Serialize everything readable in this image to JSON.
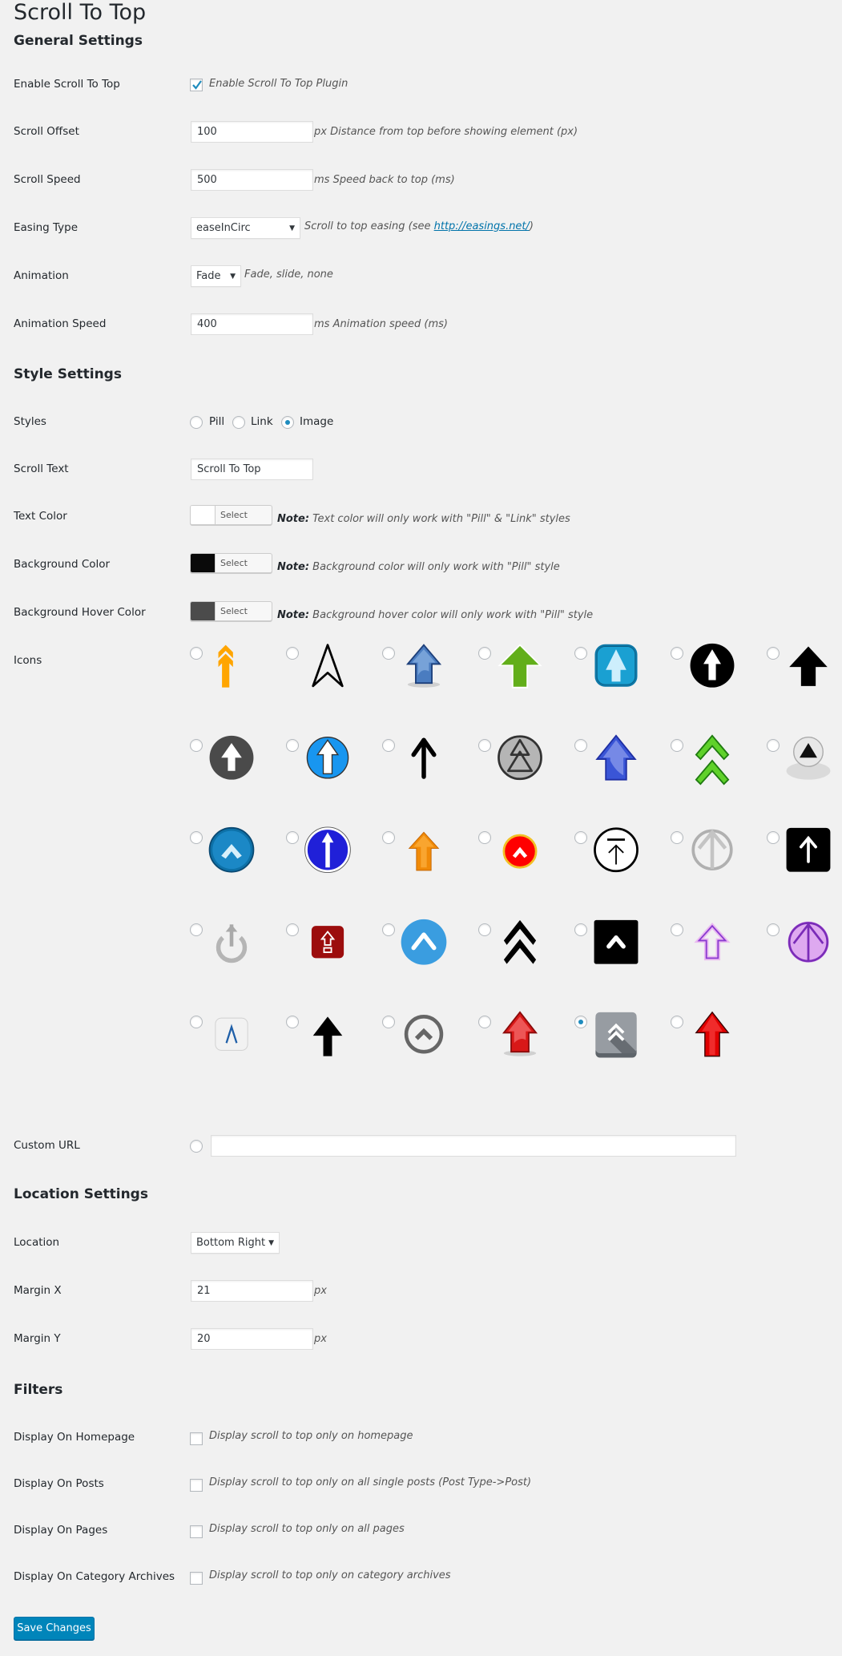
{
  "page": {
    "title": "Scroll To Top"
  },
  "general": {
    "heading": "General Settings",
    "enable": {
      "label": "Enable Scroll To Top",
      "checked": true,
      "desc": "Enable Scroll To Top Plugin"
    },
    "offset": {
      "label": "Scroll Offset",
      "value": "100",
      "desc": "px Distance from top before showing element (px)"
    },
    "speed": {
      "label": "Scroll Speed",
      "value": "500",
      "desc": "ms Speed back to top (ms)"
    },
    "easing": {
      "label": "Easing Type",
      "value": "easeInCirc",
      "desc_prefix": "Scroll to top easing (see ",
      "link": "http://easings.net/",
      "desc_suffix": ")"
    },
    "animation": {
      "label": "Animation",
      "value": "Fade",
      "desc": "Fade, slide, none"
    },
    "anim_speed": {
      "label": "Animation Speed",
      "value": "400",
      "desc": "ms Animation speed (ms)"
    }
  },
  "style": {
    "heading": "Style Settings",
    "styles": {
      "label": "Styles",
      "options": [
        "Pill",
        "Link",
        "Image"
      ],
      "selected": "Image"
    },
    "scroll_text": {
      "label": "Scroll Text",
      "value": "Scroll To Top"
    },
    "text_color": {
      "label": "Text Color",
      "swatch": "#ffffff",
      "button": "Select Color",
      "note_bold": "Note:",
      "note": " Text color will only work with \"Pill\" & \"Link\" styles"
    },
    "bg_color": {
      "label": "Background Color",
      "swatch": "#0a0a0a",
      "button": "Select Color",
      "note_bold": "Note:",
      "note": " Background color will only work with \"Pill\" style"
    },
    "bg_hover": {
      "label": "Background Hover Color",
      "swatch": "#4b4b4b",
      "button": "Select Color",
      "note_bold": "Note:",
      "note": " Background hover color will only work with \"Pill\" style"
    },
    "icons": {
      "label": "Icons",
      "selected_index": 32,
      "items": [
        "orange-double-arrow-up-icon",
        "outline-navigation-arrow-icon",
        "blue-glossy-arrow-up-icon",
        "green-arrow-up-icon",
        "blue-square-glossy-arrow-icon",
        "black-circle-arrow-up-icon",
        "black-arrow-up-icon",
        "dark-gray-circle-arrow-up-icon",
        "blue-circle-arrow-up-icon",
        "black-thin-arrow-up-icon",
        "gray-circle-double-chevron-icon",
        "blue-gradient-arrow-up-icon",
        "green-double-chevron-up-icon",
        "silver-orb-triangle-icon",
        "blue-circle-chevron-up-icon",
        "blue-sign-arrow-up-icon",
        "orange-gradient-arrow-up-icon",
        "red-circle-chevron-up-icon",
        "circle-arrow-to-top-icon",
        "silver-circle-arrow-up-icon",
        "black-square-arrow-up-icon",
        "silver-power-arrow-icon",
        "red-square-arrow-up-icon",
        "blue-circle-caret-up-icon",
        "black-double-chevron-up-icon",
        "black-square-caret-up-icon",
        "purple-neon-arrow-up-icon",
        "purple-neon-circle-arrow-icon",
        "white-tile-caret-up-icon",
        "black-bold-arrow-up-icon",
        "gray-ring-chevron-up-icon",
        "red-glossy-arrow-up-icon",
        "gray-tile-double-chevron-icon",
        "red-gradient-arrow-up-icon"
      ]
    },
    "custom_url": {
      "label": "Custom URL",
      "value": ""
    }
  },
  "location": {
    "heading": "Location Settings",
    "location": {
      "label": "Location",
      "value": "Bottom Right"
    },
    "margin_x": {
      "label": "Margin X",
      "value": "21",
      "unit": "px"
    },
    "margin_y": {
      "label": "Margin Y",
      "value": "20",
      "unit": "px"
    }
  },
  "filters": {
    "heading": "Filters",
    "items": [
      {
        "label": "Display On Homepage",
        "checked": false,
        "desc": "Display scroll to top only on homepage"
      },
      {
        "label": "Display On Posts",
        "checked": false,
        "desc": "Display scroll to top only on all single posts (Post Type->Post)"
      },
      {
        "label": "Display On Pages",
        "checked": false,
        "desc": "Display scroll to top only on all pages"
      },
      {
        "label": "Display On Category Archives",
        "checked": false,
        "desc": "Display scroll to top only on category archives"
      }
    ]
  },
  "actions": {
    "save": "Save Changes"
  }
}
